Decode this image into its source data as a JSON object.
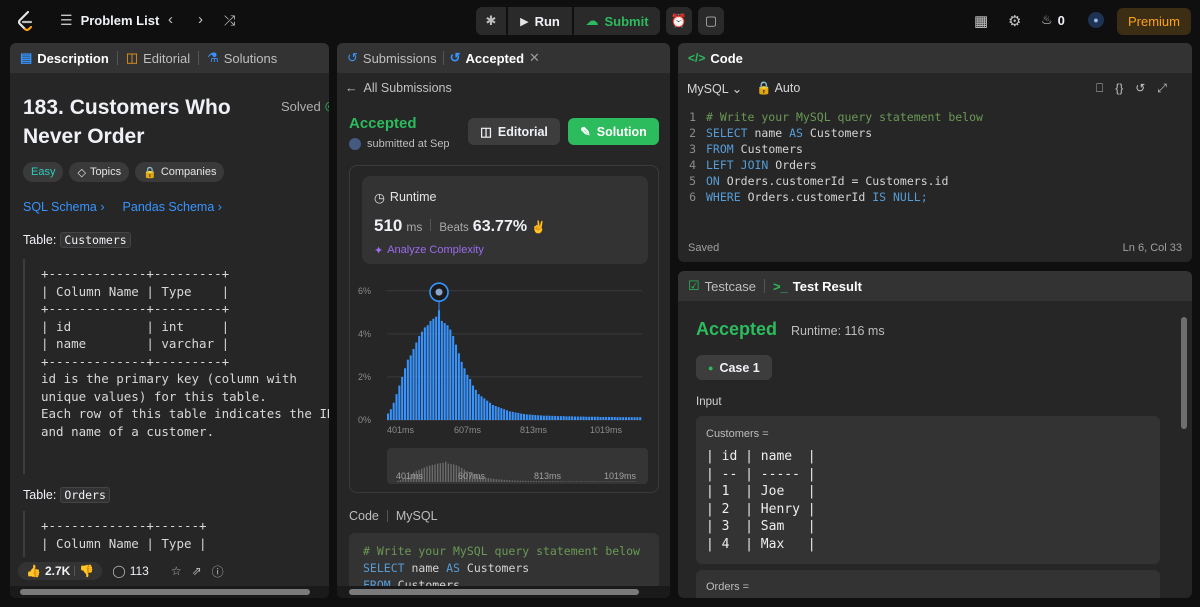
{
  "topbar": {
    "problem_list": "Problem List",
    "run": "Run",
    "submit": "Submit",
    "streak_count": "0",
    "premium": "Premium"
  },
  "left": {
    "tabs": [
      "Description",
      "Editorial",
      "Solutions"
    ],
    "title_line1": "183. Customers Who",
    "title_line2": "Never Order",
    "solved": "Solved",
    "tags": [
      "Easy",
      "Topics",
      "Companies"
    ],
    "schema_links": [
      "SQL Schema",
      "Pandas Schema"
    ],
    "table1_label": "Table:",
    "table1_name": "Customers",
    "table1_ascii": "+-------------+---------+\n| Column Name | Type    |\n+-------------+---------+\n| id          | int     |\n| name        | varchar |\n+-------------+---------+\nid is the primary key (column with\nunique values) for this table.\nEach row of this table indicates the ID\nand name of a customer.",
    "table2_label": "Table:",
    "table2_name": "Orders",
    "table2_ascii": "+-------------+------+\n| Column Name | Type |",
    "likes": "2.7K",
    "comments": "113"
  },
  "middle": {
    "tabs": [
      "Submissions",
      "Accepted"
    ],
    "back": "All Submissions",
    "status": "Accepted",
    "submitted": "submitted at Sep",
    "editorial_btn": "Editorial",
    "solution_btn": "Solution",
    "runtime_label": "Runtime",
    "runtime_value": "510",
    "runtime_unit": "ms",
    "beats_label": "Beats",
    "beats_value": "63.77%",
    "analyze": "Analyze Complexity",
    "code_label": "Code",
    "code_lang": "MySQL",
    "code_preview": [
      "# Write your MySQL query statement below",
      "SELECT name AS Customers",
      "FROM Customers"
    ]
  },
  "chart_data": {
    "type": "bar",
    "title": "",
    "xlabel": "",
    "ylabel": "",
    "ylim": [
      0,
      6.5
    ],
    "y_ticks": [
      "6%",
      "4%",
      "2%",
      "0%"
    ],
    "x_ticks": [
      "401ms",
      "607ms",
      "813ms",
      "1019ms"
    ],
    "highlight_index": 18,
    "values": [
      0.3,
      0.5,
      0.8,
      1.2,
      1.6,
      2.0,
      2.4,
      2.8,
      3.0,
      3.3,
      3.6,
      3.9,
      4.1,
      4.3,
      4.4,
      4.6,
      4.7,
      4.8,
      5.1,
      4.6,
      4.5,
      4.4,
      4.2,
      3.9,
      3.5,
      3.1,
      2.7,
      2.4,
      2.1,
      1.9,
      1.6,
      1.4,
      1.2,
      1.1,
      1.0,
      0.9,
      0.8,
      0.7,
      0.65,
      0.6,
      0.55,
      0.5,
      0.45,
      0.4,
      0.38,
      0.35,
      0.33,
      0.3,
      0.28,
      0.26,
      0.25,
      0.24,
      0.23,
      0.22,
      0.21,
      0.2,
      0.2,
      0.2,
      0.19,
      0.19,
      0.18,
      0.18,
      0.18,
      0.17,
      0.17,
      0.17,
      0.16,
      0.16,
      0.16,
      0.16,
      0.15,
      0.15,
      0.15,
      0.15,
      0.15,
      0.14,
      0.14,
      0.14,
      0.14,
      0.14,
      0.14,
      0.13,
      0.13,
      0.13,
      0.13,
      0.13,
      0.13,
      0.13,
      0.13,
      0.13
    ],
    "series_color": "#3794ff",
    "mini_ticks": [
      "401ms",
      "607ms",
      "813ms",
      "1019ms"
    ]
  },
  "editor": {
    "tab": "Code",
    "language": "MySQL",
    "mode": "Auto",
    "saved": "Saved",
    "cursor": "Ln 6, Col 33",
    "lines": [
      "# Write your MySQL query statement below",
      "SELECT name AS Customers",
      "FROM Customers",
      "LEFT JOIN Orders",
      "ON Orders.customerId = Customers.id",
      "WHERE Orders.customerId IS NULL;"
    ]
  },
  "result": {
    "tabs": [
      "Testcase",
      "Test Result"
    ],
    "status": "Accepted",
    "runtime": "Runtime: 116 ms",
    "case": "Case 1",
    "input_label": "Input",
    "customers_label": "Customers =",
    "customers_table": "| id | name  |\n| -- | ----- |\n| 1  | Joe   |\n| 2  | Henry |\n| 3  | Sam   |\n| 4  | Max   |",
    "orders_label": "Orders ="
  },
  "colors": {
    "accent_green": "#2cbb5d",
    "accent_orange": "#ffa116",
    "accent_blue": "#3794ff"
  }
}
